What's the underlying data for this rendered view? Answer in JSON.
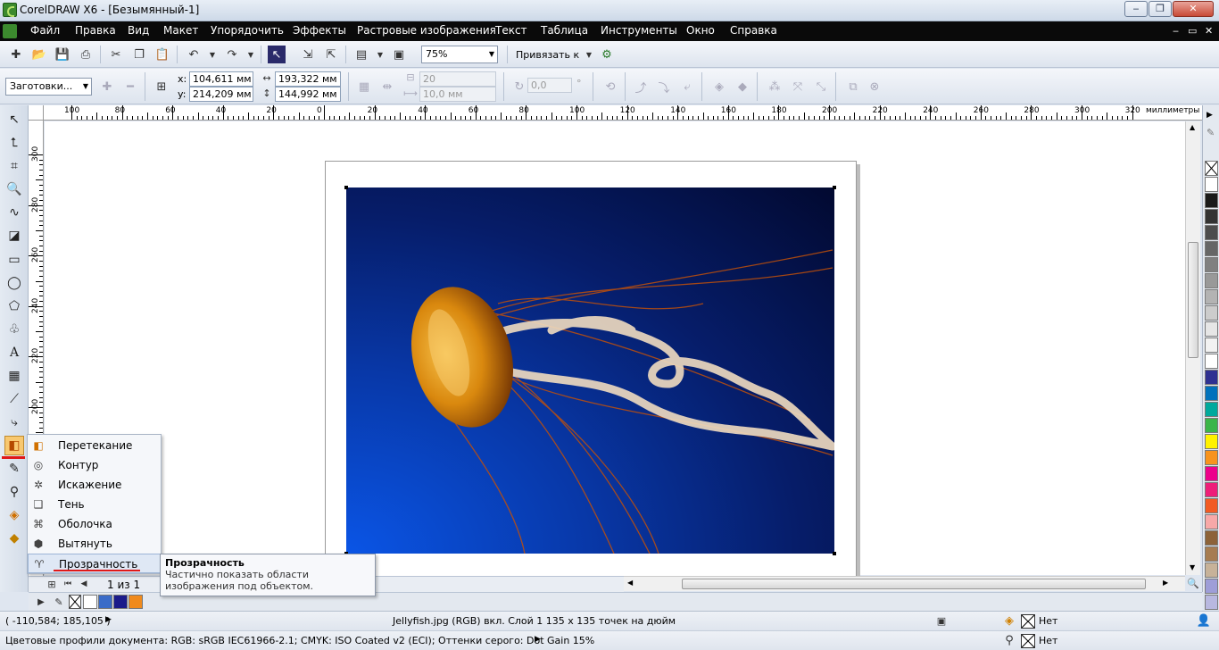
{
  "window": {
    "title": "CorelDRAW X6 - [Безымянный-1]",
    "minimize": "‒",
    "maximize": "❐",
    "close": "✕"
  },
  "menu": {
    "items": [
      "Файл",
      "Правка",
      "Вид",
      "Макет",
      "Упорядочить",
      "Эффекты",
      "Растровые изображения",
      "Текст",
      "Таблица",
      "Инструменты",
      "Окно",
      "Справка"
    ],
    "doc_controls": [
      "‒",
      "▭",
      "✕"
    ]
  },
  "toolbar": {
    "zoom": "75%",
    "snap": "Привязать к"
  },
  "property_bar": {
    "presets": "Заготовки...",
    "x_label": "x:",
    "x_value": "104,611 мм",
    "y_label": "y:",
    "y_value": "214,209 мм",
    "width_value": "193,322 мм",
    "height_value": "144,992 мм",
    "scale_value": "20",
    "spacing_value": "10,0 мм",
    "angle_value": "0,0",
    "degree": "°"
  },
  "rulers": {
    "units": "миллиметры",
    "h_labels": [
      "100",
      "80",
      "60",
      "40",
      "20",
      "0",
      "20",
      "40",
      "60",
      "80",
      "100",
      "120",
      "140",
      "160",
      "180",
      "200",
      "220",
      "240",
      "260",
      "280",
      "300",
      "320"
    ],
    "v_labels": [
      "300",
      "280",
      "260",
      "240",
      "220",
      "200"
    ]
  },
  "flyout": {
    "items": [
      {
        "label": "Перетекание",
        "icon": "blend-icon"
      },
      {
        "label": "Контур",
        "icon": "contour-icon"
      },
      {
        "label": "Искажение",
        "icon": "distort-icon"
      },
      {
        "label": "Тень",
        "icon": "shadow-icon"
      },
      {
        "label": "Оболочка",
        "icon": "envelope-icon"
      },
      {
        "label": "Вытянуть",
        "icon": "extrude-icon"
      },
      {
        "label": "Прозрачность",
        "icon": "transparency-icon"
      }
    ]
  },
  "tooltip": {
    "title": "Прозрачность",
    "text": "Частично показать области изображения под объектом."
  },
  "page_nav": {
    "page_info": "1 из 1"
  },
  "palette": {
    "colors": [
      "#ffffff",
      "#1a1a1a",
      "#333333",
      "#4d4d4d",
      "#666666",
      "#808080",
      "#999999",
      "#b3b3b3",
      "#cccccc",
      "#e6e6e6",
      "#f2f2f2",
      "#ffffff",
      "#2e3192",
      "#0071bc",
      "#00a99d",
      "#39b54a",
      "#fff200",
      "#f7931e",
      "#ec008c",
      "#ed1e79",
      "#f15a24",
      "#f7a8a8",
      "#8c6239",
      "#a67c52",
      "#c7b299",
      "#9e9ed8",
      "#b8b8e0"
    ]
  },
  "doc_palette": {
    "colors": [
      "#ffffff",
      "#3a6cc8",
      "#1b1b8a",
      "#f08a1c"
    ]
  },
  "status": {
    "coords": "( -110,584; 185,105 )",
    "object_info": "Jellyfish.jpg (RGB) вкл. Слой 1 135 x 135 точек на дюйм",
    "fill_value": "Нет",
    "outline_value": "Нет",
    "color_profiles": "Цветовые профили документа: RGB: sRGB IEC61966-2.1; CMYK: ISO Coated v2 (ECI); Оттенки серого: Dot Gain 15%"
  }
}
